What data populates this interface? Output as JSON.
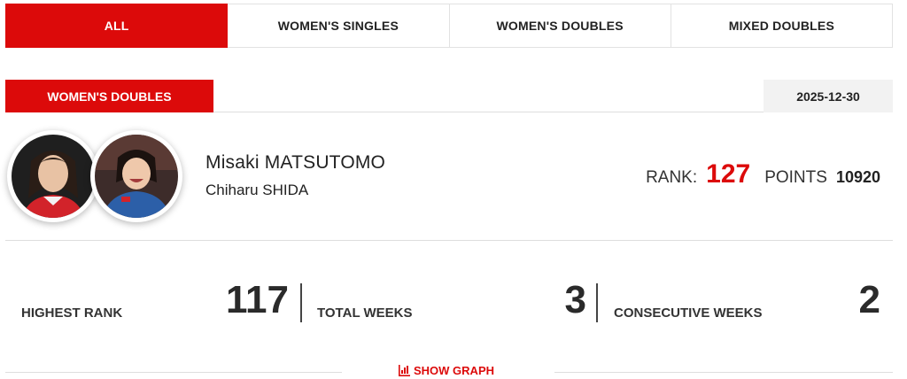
{
  "tabs": [
    {
      "label": "ALL",
      "active": true
    },
    {
      "label": "WOMEN'S SINGLES",
      "active": false
    },
    {
      "label": "WOMEN'S DOUBLES",
      "active": false
    },
    {
      "label": "MIXED DOUBLES",
      "active": false
    }
  ],
  "category": "WOMEN'S DOUBLES",
  "date": "2025-12-30",
  "players": [
    "Misaki MATSUTOMO",
    "Chiharu SHIDA"
  ],
  "ranking": {
    "rank_label": "RANK:",
    "rank_value": "127",
    "points_label": "POINTS",
    "points_value": "10920"
  },
  "stats": {
    "highest_rank_label": "HIGHEST RANK",
    "highest_rank_value": "117",
    "total_weeks_label": "TOTAL WEEKS",
    "total_weeks_value": "3",
    "consecutive_weeks_label": "CONSECUTIVE WEEKS",
    "consecutive_weeks_value": "2"
  },
  "show_graph_label": "SHOW GRAPH",
  "colors": {
    "accent": "#dc0a0a",
    "text": "#222222",
    "divider": "#dedede"
  },
  "icons": {
    "graph": "chart-bar-icon",
    "avatars": [
      "player-photo-icon",
      "player-photo-icon"
    ]
  }
}
